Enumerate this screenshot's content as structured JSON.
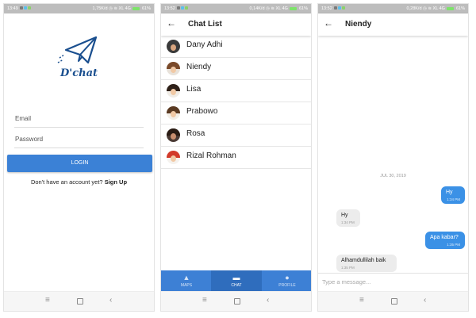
{
  "screens": {
    "login": {
      "status": {
        "time": "13:49",
        "speed": "1,75K/d",
        "network": "XL 4G",
        "battery": "61%"
      },
      "brand": "D'chat",
      "email_placeholder": "Email",
      "password_placeholder": "Password",
      "login_label": "LOGIN",
      "signup_prompt": "Don't have an account yet?",
      "signup_link": "Sign Up"
    },
    "chat_list": {
      "status": {
        "time": "13:52",
        "speed": "0,14K/d",
        "network": "XL 4G",
        "battery": "61%"
      },
      "title": "Chat List",
      "contacts": [
        {
          "name": "Dany Adhi"
        },
        {
          "name": "Niendy"
        },
        {
          "name": "Lisa"
        },
        {
          "name": "Prabowo"
        },
        {
          "name": "Rosa"
        },
        {
          "name": "Rizal Rohman"
        }
      ],
      "tabs": [
        {
          "label": "MAPS",
          "icon": "navigation-arrow-icon"
        },
        {
          "label": "CHAT",
          "icon": "chat-bubble-icon",
          "active": true
        },
        {
          "label": "PROFILE",
          "icon": "person-icon"
        }
      ]
    },
    "conversation": {
      "status": {
        "time": "13:52",
        "speed": "0,28K/d",
        "network": "XL 4G",
        "battery": "61%"
      },
      "title": "Niendy",
      "date_separator": "JUL 30, 2019",
      "messages": [
        {
          "text": "Hy",
          "time": "1:34 PM",
          "direction": "outgoing"
        },
        {
          "text": "Hy",
          "time": "1:34 PM",
          "direction": "incoming"
        },
        {
          "text": "Apa kabar?",
          "time": "1:35 PM",
          "direction": "outgoing"
        },
        {
          "text": "Alhamdullilah baik",
          "time": "1:35 PM",
          "direction": "incoming"
        }
      ],
      "input_placeholder": "Type a message..."
    }
  },
  "colors": {
    "primary": "#3b81d6",
    "tab_active": "#2f6dbd",
    "outgoing_bubble": "#3b91e6",
    "incoming_bubble": "#ececec",
    "brand": "#1a4f8f"
  }
}
